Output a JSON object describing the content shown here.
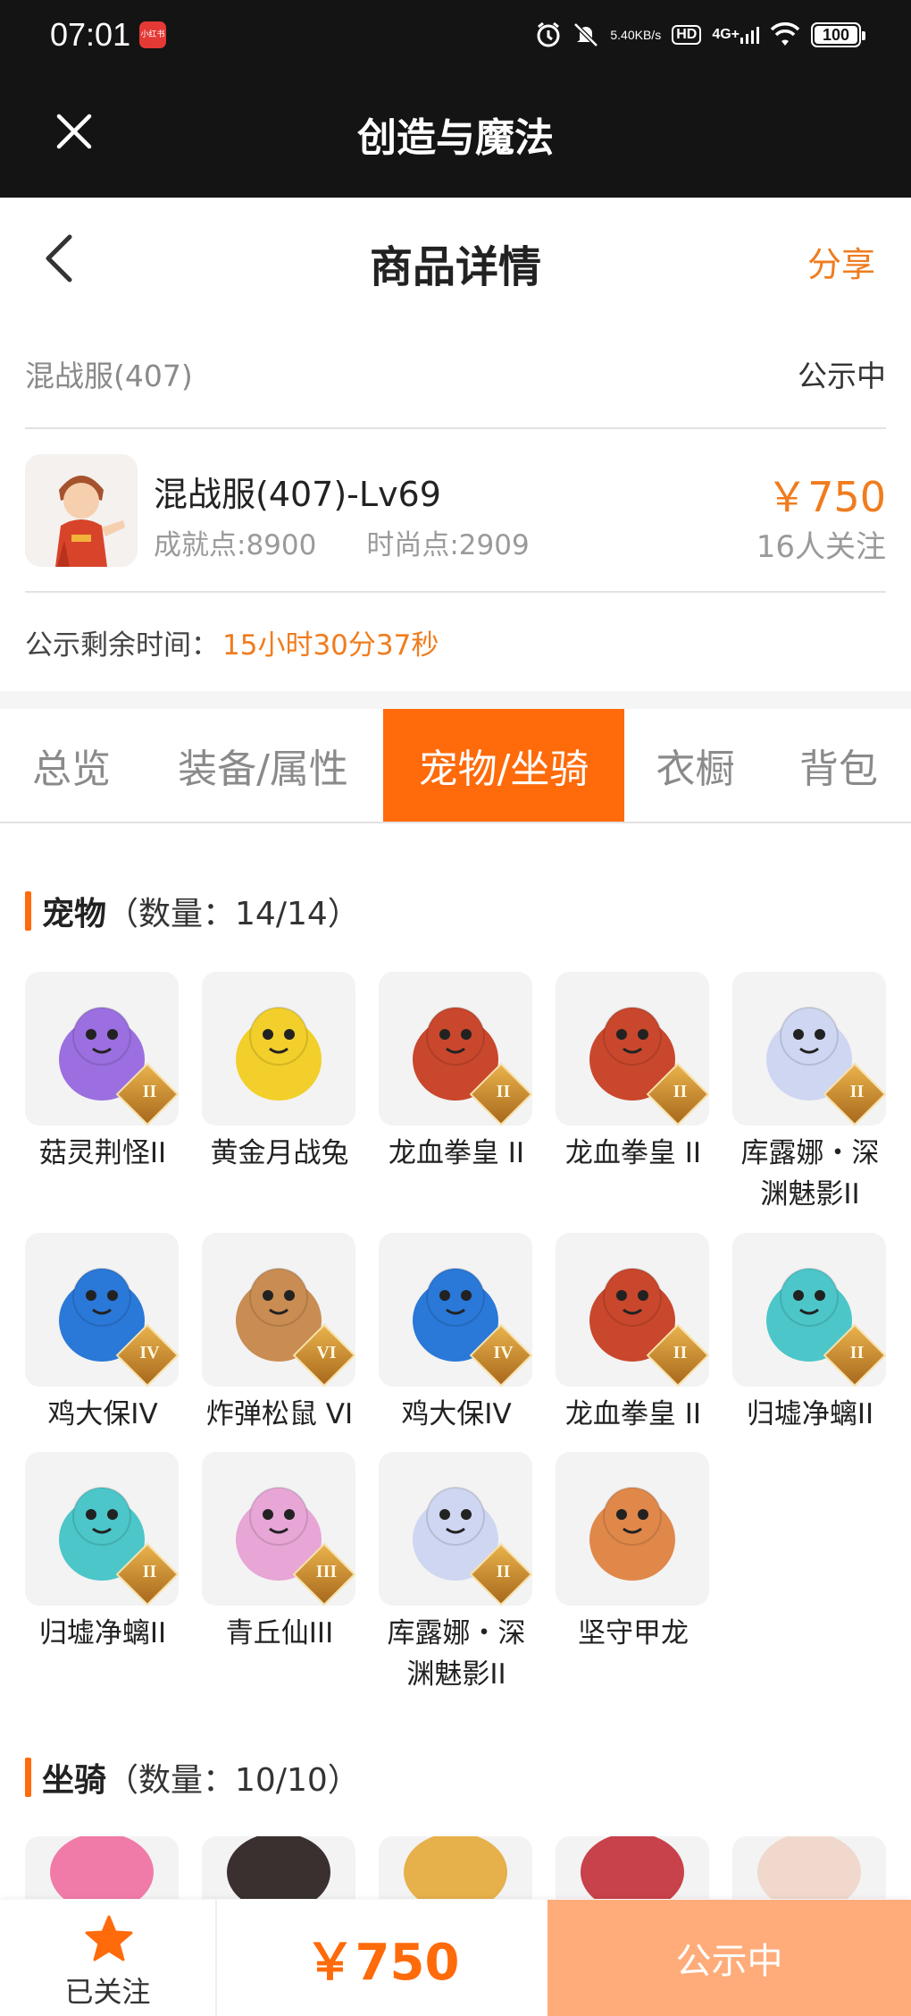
{
  "status_bar": {
    "time": "07:01",
    "app_badge": "小红书",
    "net_speed_value": "5.40",
    "net_speed_unit": "KB/s",
    "hd": "HD",
    "network": "4G+",
    "battery": "100"
  },
  "titlebar": {
    "title": "创造与魔法"
  },
  "page": {
    "title": "商品详情",
    "share": "分享"
  },
  "server": {
    "name": "混战服(407)",
    "status": "公示中"
  },
  "item": {
    "name": "混战服(407)-Lv69",
    "achievement": "成就点:8900",
    "fashion": "时尚点:2909",
    "price": "￥750",
    "followers": "16人关注"
  },
  "remain": {
    "label": "公示剩余时间：",
    "value": "15小时30分37秒"
  },
  "tabs": [
    {
      "label": "总览"
    },
    {
      "label": "装备/属性"
    },
    {
      "label": "宠物/坐骑"
    },
    {
      "label": "衣橱"
    },
    {
      "label": "背包"
    }
  ],
  "active_tab": "宠物/坐骑",
  "pets_section": {
    "title": "宠物",
    "count": "（数量：14/14）"
  },
  "pets": [
    {
      "name": "菇灵荆怪II",
      "tier": "II",
      "color": "#9b6fe0"
    },
    {
      "name": "黄金月战兔",
      "tier": "",
      "color": "#f2cf2a"
    },
    {
      "name": "龙血拳皇 II",
      "tier": "II",
      "color": "#c9472c"
    },
    {
      "name": "龙血拳皇 II",
      "tier": "II",
      "color": "#c9472c"
    },
    {
      "name": "库露娜・深渊魅影II",
      "tier": "II",
      "color": "#cfd6f2"
    },
    {
      "name": "鸡大保IV",
      "tier": "IV",
      "color": "#2a78d8"
    },
    {
      "name": "炸弹松鼠 VI",
      "tier": "VI",
      "color": "#c98c52"
    },
    {
      "name": "鸡大保IV",
      "tier": "IV",
      "color": "#2a78d8"
    },
    {
      "name": "龙血拳皇 II",
      "tier": "II",
      "color": "#c9472c"
    },
    {
      "name": "归墟净螭II",
      "tier": "II",
      "color": "#4cc6c9"
    },
    {
      "name": "归墟净螭II",
      "tier": "II",
      "color": "#4cc6c9"
    },
    {
      "name": "青丘仙III",
      "tier": "III",
      "color": "#e7a6d6"
    },
    {
      "name": "库露娜・深渊魅影II",
      "tier": "II",
      "color": "#cfd6f2"
    },
    {
      "name": "坚守甲龙",
      "tier": "",
      "color": "#e0884a"
    }
  ],
  "mounts_section": {
    "title": "坐骑",
    "count": "（数量：10/10）"
  },
  "mount_colors": [
    "#f07aa8",
    "#3a3030",
    "#e6b04a",
    "#c7424a",
    "#f0d8cc"
  ],
  "bottom": {
    "fav_label": "已关注",
    "price": "￥750",
    "status": "公示中"
  },
  "colors": {
    "accent": "#ff6a0a",
    "price": "#f07c1e",
    "status_btn": "#ffac7a"
  }
}
